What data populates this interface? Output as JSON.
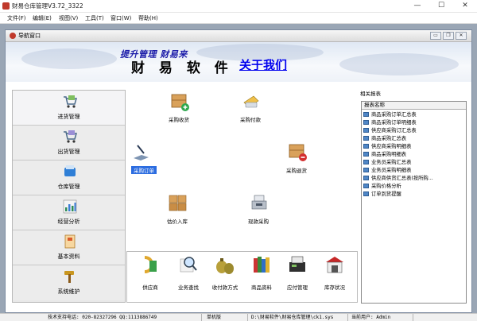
{
  "window": {
    "title": "财易仓库管理V3.72_3322",
    "minimize": "—",
    "maximize": "☐",
    "close": "✕"
  },
  "menu": [
    {
      "label": "文件(F)"
    },
    {
      "label": "编辑(E)"
    },
    {
      "label": "视图(V)"
    },
    {
      "label": "工具(T)"
    },
    {
      "label": "窗口(W)"
    },
    {
      "label": "帮助(H)"
    }
  ],
  "child_window": {
    "title": "导航窗口",
    "btn_min": "▭",
    "btn_restore": "❐",
    "btn_close": "✕"
  },
  "banner": {
    "brand": "财 易 软 件",
    "about_link": "关于我们",
    "slogan": "提升管理 财易来"
  },
  "left_nav": [
    {
      "label": "进货管理",
      "icon": "cart-icon",
      "active": true
    },
    {
      "label": "出货管理",
      "icon": "cart-out-icon",
      "active": false
    },
    {
      "label": "仓库管理",
      "icon": "warehouse-icon",
      "active": false
    },
    {
      "label": "经营分析",
      "icon": "bar-chart-icon",
      "active": false
    },
    {
      "label": "基本资料",
      "icon": "document-icon",
      "active": false
    },
    {
      "label": "系统维护",
      "icon": "hammer-icon",
      "active": false
    }
  ],
  "workarea": {
    "items": [
      {
        "label": "采购收货",
        "icon": "box-add-icon"
      },
      {
        "label": "采购付款",
        "icon": "pay-card-icon"
      },
      {
        "label": "采购订单",
        "icon": "order-pen-icon",
        "selected": true
      },
      {
        "label": "采购退货",
        "icon": "box-remove-icon"
      },
      {
        "label": "估价入库",
        "icon": "boxes-icon"
      },
      {
        "label": "现款采购",
        "icon": "cash-register-icon"
      }
    ]
  },
  "bottom_toolbar": [
    {
      "label": "供应商",
      "icon": "supplier-icon"
    },
    {
      "label": "业务查找",
      "icon": "magnifier-icon"
    },
    {
      "label": "收付款方式",
      "icon": "money-bags-icon"
    },
    {
      "label": "商品资料",
      "icon": "books-icon"
    },
    {
      "label": "应付管理",
      "icon": "cash-register-icon"
    },
    {
      "label": "库存状况",
      "icon": "storehouse-icon"
    }
  ],
  "related": {
    "title": "相关报表",
    "column": "报表名称",
    "rows": [
      "商品采购订单汇总表",
      "商品采购订单明细表",
      "供应商采购订汇总表",
      "商品采购汇总表",
      "供应商采购明细表",
      "商品采购明细表",
      "业务员采购汇总表",
      "业务员采购明细表",
      "供应商供货汇总表(按所购...",
      "采购价格分析",
      "订单到货提醒"
    ]
  },
  "status": {
    "support": "技术支持电话: 020-82327296 QQ:1113886749",
    "edition": "单机版",
    "path": "D:\\财易软件\\财易仓库管理\\ck1.sys",
    "user": "当前用户: Admin"
  },
  "colors": {
    "link": "#0000ee",
    "slogan": "#1a1aa8",
    "selection": "#2b6ce0",
    "accent_red": "#c0392b"
  }
}
